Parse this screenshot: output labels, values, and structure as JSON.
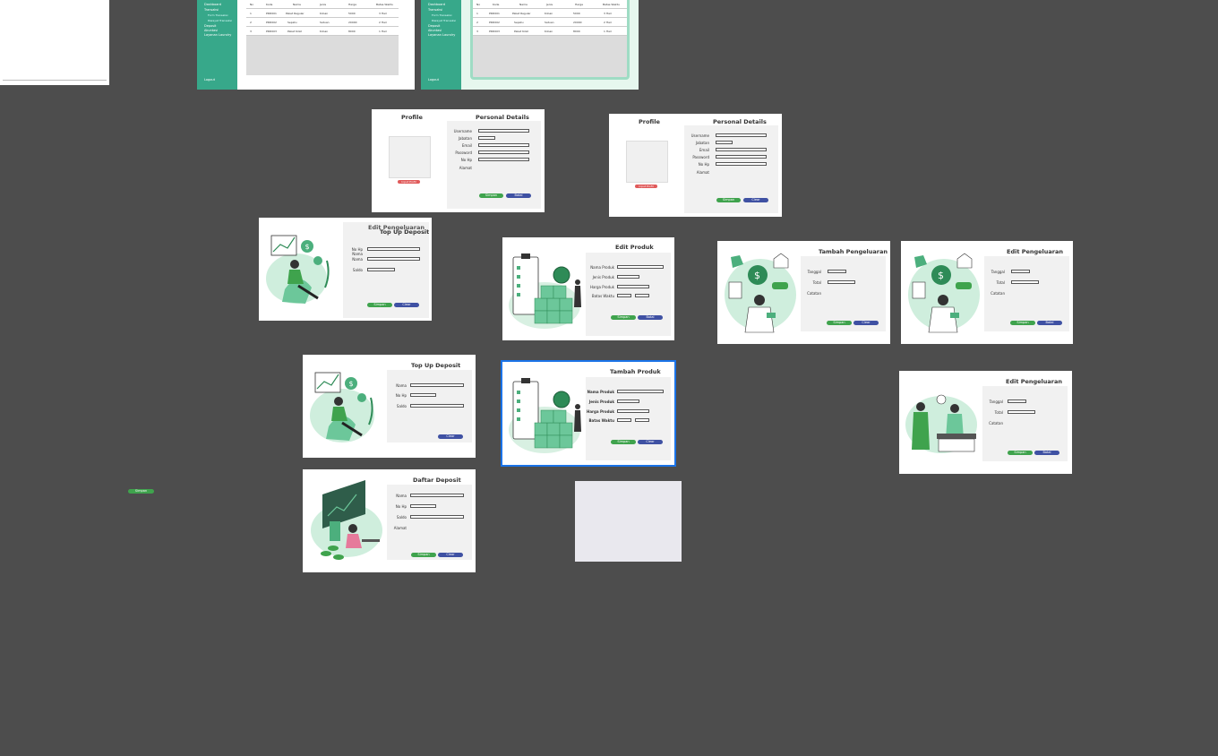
{
  "sidebar": {
    "items": [
      "Dashboard",
      "Transaksi",
      "Form Transaksi",
      "Riwayat Transaksi",
      "Deposit",
      "Akuntasi",
      "Layanan Laundry"
    ],
    "logout": "Logout"
  },
  "table": {
    "headers": [
      "No",
      "Kode",
      "Nama",
      "Jenis",
      "Harga",
      "Batas Waktu"
    ],
    "rows": [
      [
        "1",
        "PRD001",
        "Paket Reguler",
        "Kiloan",
        "5000",
        "3 Hari"
      ],
      [
        "2",
        "PRD002",
        "Sepatu",
        "Satuan",
        "20000",
        "2 Hari"
      ],
      [
        "3",
        "PRD003",
        "Paket Kilat",
        "Kiloan",
        "8000",
        "1 Hari"
      ]
    ]
  },
  "profile_a": {
    "title": "Profile",
    "details_title": "Personal Details",
    "fields": [
      "Username",
      "Jabatan",
      "Email",
      "Password",
      "No Hp",
      "Alamat"
    ],
    "upload": "Input Profil",
    "save": "Simpan",
    "cancel": "Batal"
  },
  "profile_b": {
    "title": "Profile",
    "details_title": "Personal Details",
    "fields": [
      "Username",
      "Jabatan",
      "Email",
      "Password",
      "No Hp",
      "Alamat"
    ],
    "upload": "Input Profil",
    "save": "Simpan",
    "clear": "Clear"
  },
  "deposit_overlap": {
    "title_back": "Edit Pengeluaran",
    "title_front": "Top Up Deposit",
    "fields": [
      "No Hp",
      "Nama",
      "Nama",
      "Saldo"
    ],
    "save": "Simpan",
    "clear": "Clear"
  },
  "edit_produk": {
    "title": "Edit Produk",
    "fields": [
      "Nama Produk",
      "Jenis Produk",
      "Harga Produk",
      "Batas Waktu"
    ],
    "save": "Simpan",
    "cancel": "Batal"
  },
  "tambah_pengeluaran": {
    "title": "Tambah Pengeluaran",
    "fields": [
      "Tanggal",
      "Total",
      "Catatan"
    ],
    "save": "Simpan",
    "clear": "Clear"
  },
  "edit_pengeluaran_a": {
    "title": "Edit Pengeluaran",
    "fields": [
      "Tanggal",
      "Total",
      "Catatan"
    ],
    "save": "Simpan",
    "cancel": "Batal"
  },
  "topup_deposit": {
    "title": "Top Up Deposit",
    "fields": [
      "Nama",
      "No Hp",
      "Saldo"
    ],
    "clear": "Clear"
  },
  "tambah_produk": {
    "title": "Tambah Produk",
    "fields": [
      "Nama Produk",
      "Jenis Produk",
      "Harga Produk",
      "Batas Waktu"
    ],
    "save": "Simpan",
    "clear": "Clear"
  },
  "edit_pengeluaran_b": {
    "title": "Edit Pengeluaran",
    "fields": [
      "Tanggal",
      "Total",
      "Catatan"
    ],
    "save": "Simpan",
    "cancel": "Batal"
  },
  "daftar_deposit": {
    "title": "Daftar Deposit",
    "fields": [
      "Nama",
      "No Hp",
      "Saldo",
      "Alamat"
    ],
    "save": "Simpan",
    "clear": "Clear"
  },
  "stray_button": "Simpan",
  "colors": {
    "canvas": "#4d4d4d",
    "accent": "#37a88a",
    "save": "#3fa34d",
    "secondary": "#3f51a3",
    "danger": "#e05a5a",
    "selection": "#1a73e8"
  }
}
